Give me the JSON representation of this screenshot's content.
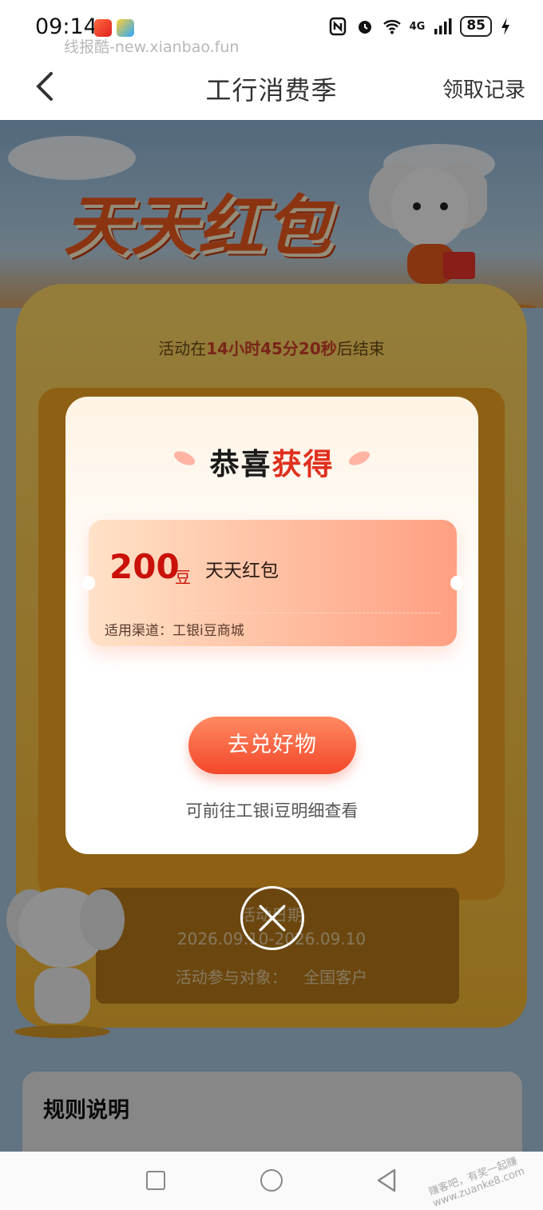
{
  "status_bar": {
    "time": "09:14",
    "watermark": "线报酷-new.xianbao.fun",
    "network_label": "4G",
    "battery": "85",
    "icons": [
      "nfc-icon",
      "alarm-icon",
      "wifi-icon",
      "signal-icon",
      "battery-icon",
      "charging-icon"
    ]
  },
  "header": {
    "title": "工行消费季",
    "record_link": "领取记录"
  },
  "background": {
    "hero_title": "天天红包",
    "countdown_prefix": "活动在",
    "countdown_value": "14小时45分20秒",
    "countdown_suffix": "后结束",
    "activity_date_label": "活动日期",
    "activity_date": "2026.09.10-2026.09.10",
    "target_label": "活动参与对象：",
    "target_value": "全国客户",
    "rules_title": "规则说明"
  },
  "modal": {
    "title_black": "恭喜",
    "title_red": "获得",
    "coupon": {
      "amount": "200",
      "unit": "豆",
      "name": "天天红包",
      "channel": "适用渠道：工银i豆商城"
    },
    "redeem_button": "去兑好物",
    "hint": "可前往工银i豆明细查看"
  },
  "corner_watermark": "赚客吧，有奖一起赚 www.zuanke8.com",
  "colors": {
    "accent_red": "#e0301e",
    "button_gradient_top": "#ff8a62",
    "button_gradient_bottom": "#f2472a"
  }
}
